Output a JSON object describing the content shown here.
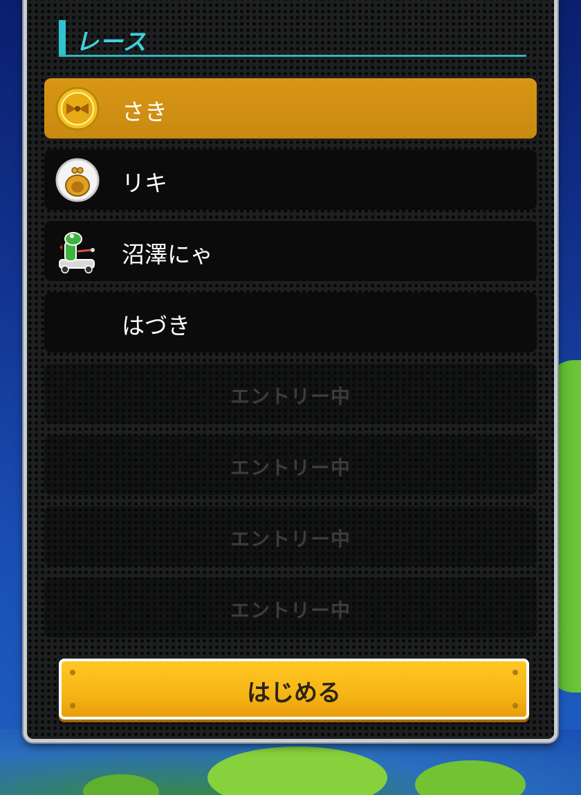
{
  "header": {
    "title": "レース"
  },
  "players": [
    {
      "name": "さき",
      "icon": "bow-coin-icon",
      "selected": true
    },
    {
      "name": "リキ",
      "icon": "money-bag-icon",
      "selected": false
    },
    {
      "name": "沼澤にゃ",
      "icon": "yoshi-kart-icon",
      "selected": false
    },
    {
      "name": "はづき",
      "icon": "",
      "selected": false
    }
  ],
  "empty_slots": [
    {
      "label": "エントリー中"
    },
    {
      "label": "エントリー中"
    },
    {
      "label": "エントリー中"
    },
    {
      "label": "エントリー中"
    }
  ],
  "start_button": {
    "label": "はじめる"
  },
  "colors": {
    "accent": "#2fc3cf",
    "highlight_row": "#d99616",
    "button": "#f7b515"
  }
}
